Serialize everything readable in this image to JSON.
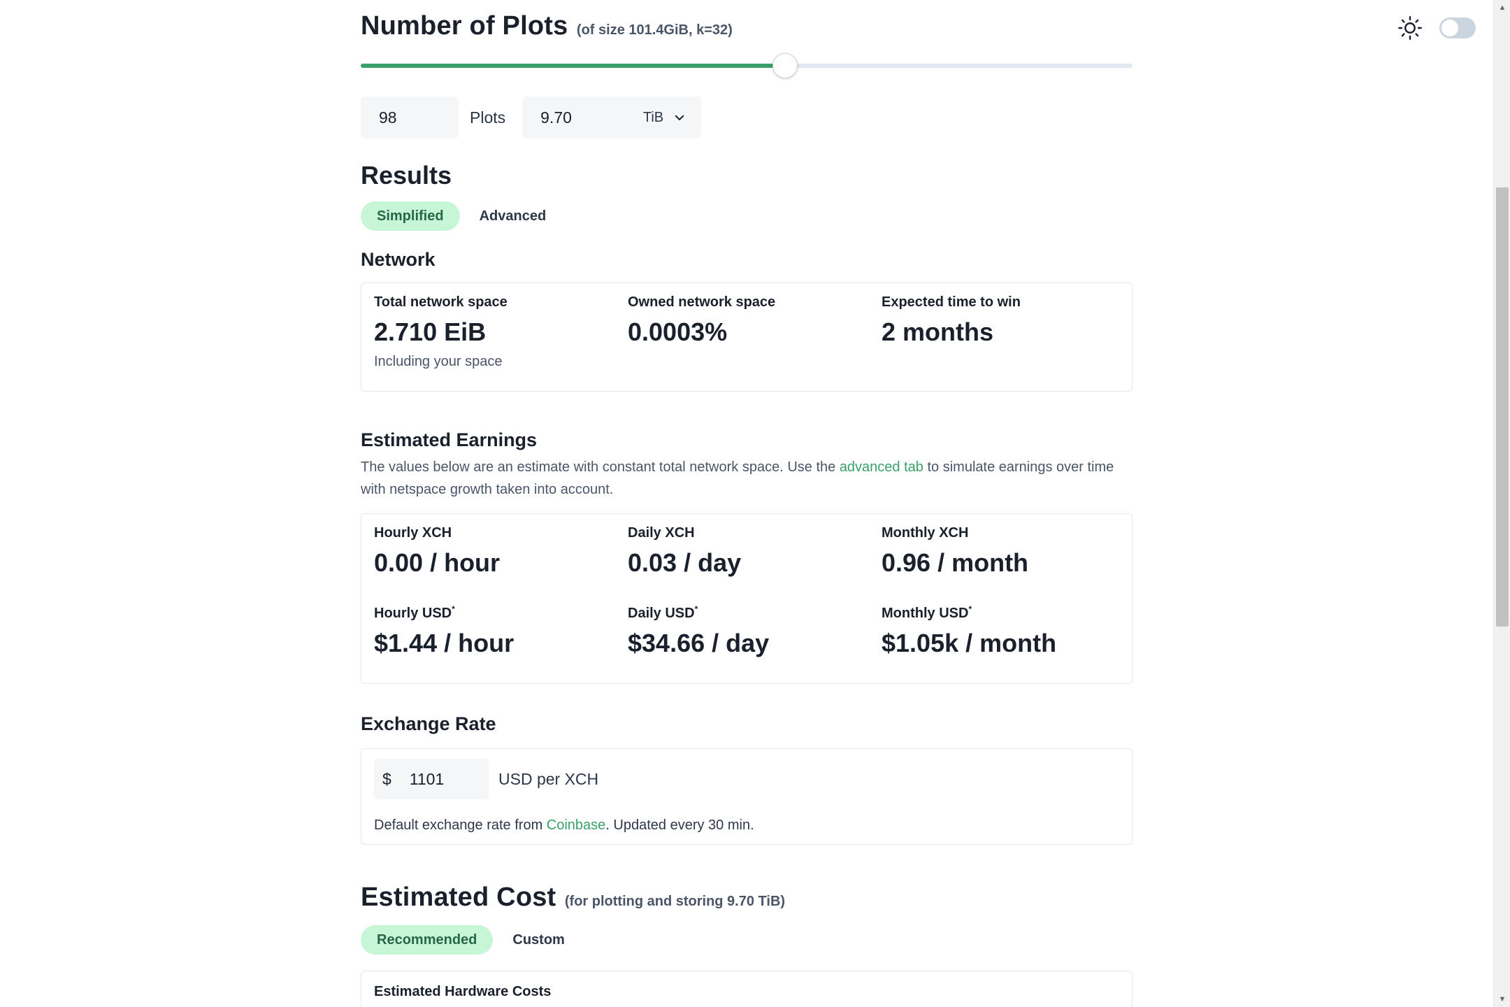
{
  "plots": {
    "title": "Number of Plots",
    "subtitle": "(of size 101.4GiB, k=32)",
    "slider_fraction": 0.55,
    "count": "98",
    "count_label": "Plots",
    "size_value": "9.70",
    "size_unit": "TiB"
  },
  "results": {
    "title": "Results",
    "tabs": [
      {
        "label": "Simplified",
        "active": true
      },
      {
        "label": "Advanced",
        "active": false
      }
    ]
  },
  "network": {
    "title": "Network",
    "stats": [
      {
        "label": "Total network space",
        "value": "2.710 EiB",
        "help": "Including your space"
      },
      {
        "label": "Owned network space",
        "value": "0.0003%"
      },
      {
        "label": "Expected time to win",
        "value": "2 months"
      }
    ]
  },
  "earnings": {
    "title": "Estimated Earnings",
    "desc_before": "The values below are an estimate with constant total network space. Use the ",
    "desc_link": "advanced tab",
    "desc_after": " to simulate earnings over time with netspace growth taken into account.",
    "xch": [
      {
        "label": "Hourly XCH",
        "value": "0.00 / hour"
      },
      {
        "label": "Daily XCH",
        "value": "0.03 / day"
      },
      {
        "label": "Monthly XCH",
        "value": "0.96 / month"
      }
    ],
    "usd": [
      {
        "label": "Hourly USD",
        "value": "$1.44 / hour"
      },
      {
        "label": "Daily USD",
        "value": "$34.66 / day"
      },
      {
        "label": "Monthly USD",
        "value": "$1.05k / month"
      }
    ],
    "footnote_mark": "*"
  },
  "exchange": {
    "title": "Exchange Rate",
    "currency_symbol": "$",
    "rate": "1101",
    "unit": "USD per XCH",
    "note_before": "Default exchange rate from ",
    "note_link": "Coinbase",
    "note_after": ". Updated every 30 min."
  },
  "cost": {
    "title": "Estimated Cost",
    "subtitle": "(for plotting and storing 9.70 TiB)",
    "tabs": [
      {
        "label": "Recommended",
        "active": true
      },
      {
        "label": "Custom",
        "active": false
      }
    ],
    "card_label": "Estimated Hardware Costs"
  },
  "icons": {
    "theme": "sun-icon",
    "select": "chevron-down-icon"
  },
  "colors": {
    "accent": "#38a169",
    "pill_bg": "#c6f6d5",
    "pill_text": "#276749"
  }
}
